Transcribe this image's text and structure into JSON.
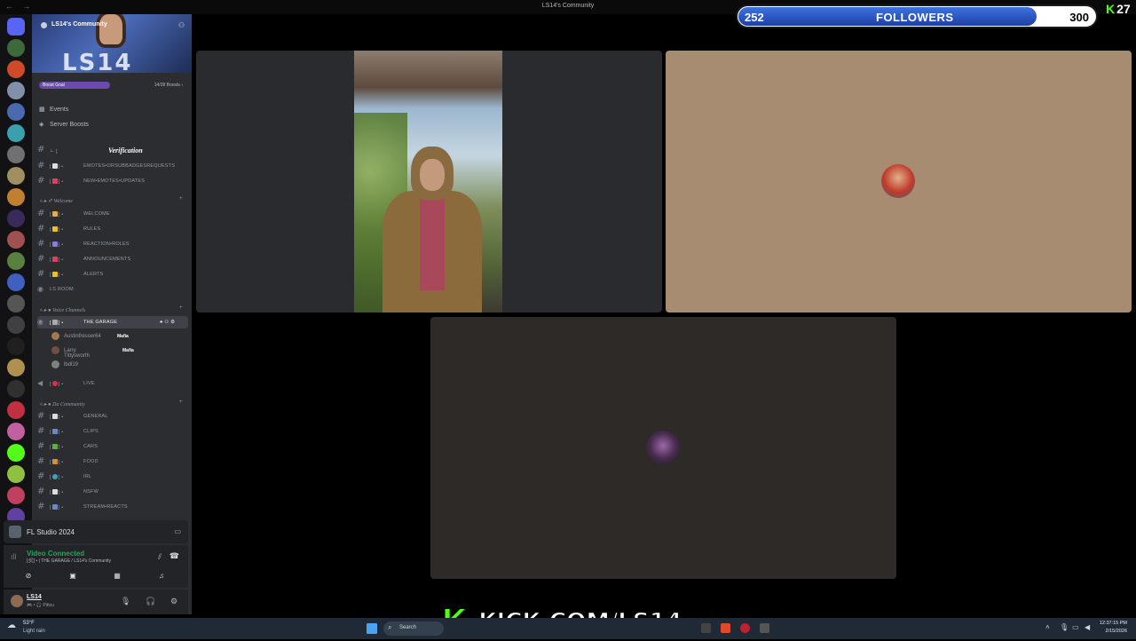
{
  "window": {
    "title": "LS14's Community",
    "nav_glyphs": "← →"
  },
  "server_rail": {
    "servers": [
      {
        "icon": "discord-home-icon",
        "color": "#5865f2"
      },
      {
        "icon": "server-icon",
        "color": "#3d6a3a"
      },
      {
        "icon": "server-icon",
        "color": "#d04a2a"
      },
      {
        "icon": "server-icon",
        "color": "#8090a8"
      },
      {
        "icon": "server-icon",
        "color": "#4a6ab0"
      },
      {
        "icon": "server-icon",
        "color": "#3aa0b0"
      },
      {
        "icon": "server-icon",
        "color": "#707070"
      },
      {
        "icon": "server-icon",
        "color": "#a09060"
      },
      {
        "icon": "server-icon",
        "color": "#c08030"
      },
      {
        "icon": "server-icon",
        "color": "#3a2a5a"
      },
      {
        "icon": "server-icon",
        "color": "#a05050"
      },
      {
        "icon": "server-icon",
        "color": "#5a8040"
      },
      {
        "icon": "server-icon",
        "color": "#4060c0"
      },
      {
        "icon": "server-icon",
        "color": "#555555"
      },
      {
        "icon": "server-icon",
        "color": "#404040"
      },
      {
        "icon": "server-icon",
        "color": "#202020"
      },
      {
        "icon": "server-icon",
        "color": "#b09050"
      },
      {
        "icon": "server-icon",
        "color": "#303030"
      },
      {
        "icon": "server-icon",
        "color": "#c03040"
      },
      {
        "icon": "server-icon",
        "color": "#c060a0"
      },
      {
        "icon": "kick-server-icon",
        "color": "#53fc18"
      },
      {
        "icon": "server-icon",
        "color": "#90c040"
      },
      {
        "icon": "server-icon",
        "color": "#c04060"
      },
      {
        "icon": "server-icon",
        "color": "#6040a0"
      }
    ]
  },
  "sidebar": {
    "server_name": "LS14's Community",
    "banner_text": "LS14",
    "boost": {
      "label": "Boost Goal",
      "count": "14/28 Boosts ›"
    },
    "menu": [
      {
        "label": "Events",
        "icon": "calendar-icon"
      },
      {
        "label": "Server Boosts",
        "icon": "boost-icon"
      }
    ],
    "channels": {
      "verification": {
        "prefix": "ㄴ [",
        "label": "Verification"
      },
      "emotes_req": "EMOTES•ORSUBBADGESREQUESTS",
      "emotes_upd": "NEW•EMOTES•UPDATES",
      "cat_welcome": "Welcome",
      "welcome": "WELCOME",
      "rules": "RULES",
      "reaction_roles": "REACTION•ROLES",
      "announcements": "ANNOUNCEMENTS",
      "alerts": "ALERTS",
      "ls_room": "LS ROOM",
      "cat_voice": "Voice Channels",
      "the_garage": "THE GARAGE",
      "live": "LIVE",
      "cat_community": "Da Community",
      "general": "GENERAL",
      "clips": "CLIPS",
      "cars": "CARS",
      "food": "FOOD",
      "irl": "IRL",
      "nsfw": "NSFW",
      "stream_reacts": "STREAM•REACTS"
    },
    "voice_users": [
      {
        "name": "Austinfresser64",
        "tag": "Mafia",
        "color": "#a07a50"
      },
      {
        "name": "Larry Tittysworth",
        "tag": "Mafia",
        "color": "#705040"
      },
      {
        "name": "lbdl19",
        "color": "#808080"
      }
    ],
    "activity": {
      "label": "FL Studio 2024"
    },
    "voice_status": {
      "label": "Video Connected",
      "where": "[🛠] • | THE GARAGE / LS14's Community"
    },
    "user": {
      "name": "LS14",
      "status": "🎮 • 🎧 Pittsu"
    }
  },
  "overlay": {
    "followers_current": "252",
    "followers_label": "FOLLOWERS",
    "followers_goal": "300",
    "followers_progress": 0.84,
    "kick_count": "27",
    "kick_logo": "K",
    "kick_url": "KICK.COM/LS14"
  },
  "taskbar": {
    "temp": "53°F",
    "condition": "Light rain",
    "search_placeholder": "Search",
    "time": "12:37:15 PM",
    "date": "2/15/2026"
  }
}
